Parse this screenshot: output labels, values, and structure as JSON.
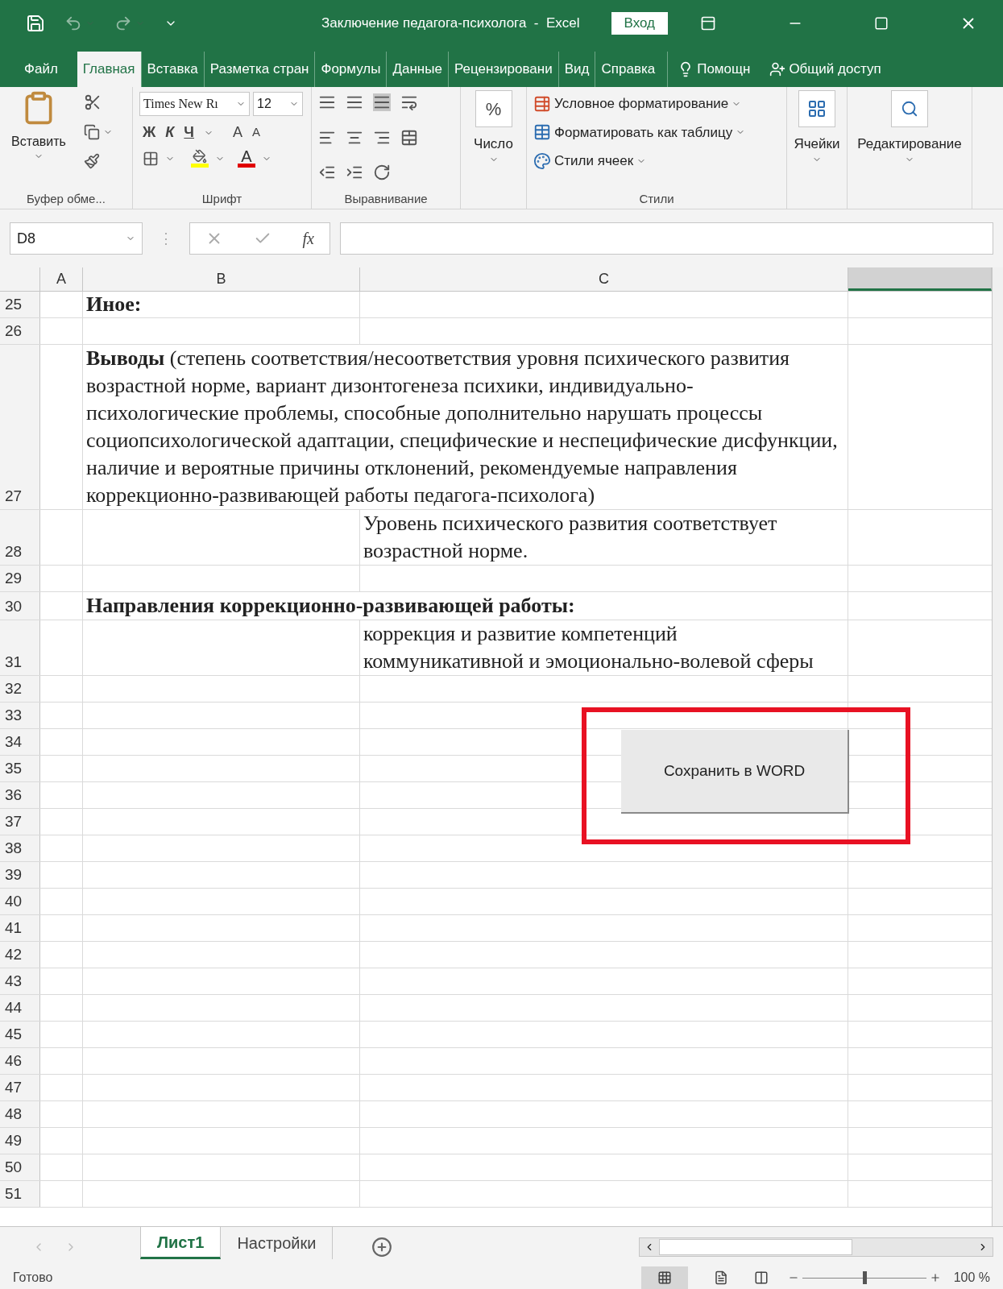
{
  "title_bar": {
    "title": "Заключение педагога-психолога  -  Excel",
    "sign_in": "Вход"
  },
  "ribbon_tabs": [
    {
      "label": "Файл",
      "kind": "tab",
      "selected": false
    },
    {
      "label": "Главная",
      "kind": "tab",
      "selected": true
    },
    {
      "label": "Вставка",
      "kind": "tab",
      "selected": false
    },
    {
      "label": "Разметка стран",
      "kind": "tab",
      "selected": false
    },
    {
      "label": "Формулы",
      "kind": "tab",
      "selected": false
    },
    {
      "label": "Данные",
      "kind": "tab",
      "selected": false
    },
    {
      "label": "Рецензировани",
      "kind": "tab",
      "selected": false
    },
    {
      "label": "Вид",
      "kind": "tab",
      "selected": false
    },
    {
      "label": "Справка",
      "kind": "tab",
      "selected": false
    },
    {
      "label": "Помощн",
      "kind": "search",
      "selected": false
    },
    {
      "label": "Общий доступ",
      "kind": "share",
      "selected": false
    }
  ],
  "ribbon": {
    "clipboard": {
      "paste": "Вставить",
      "label": "Буфер обме..."
    },
    "font": {
      "name": "Times New Rı",
      "size": "12",
      "bold": "Ж",
      "italic": "К",
      "underline": "Ч",
      "grow": "A",
      "shrink": "A",
      "text_color_letter": "A",
      "label": "Шрифт"
    },
    "alignment": {
      "label": "Выравнивание"
    },
    "number": {
      "symbol": "%",
      "format": "Число"
    },
    "styles": {
      "items": [
        "Условное форматирование",
        "Форматировать как таблицу",
        "Стили ячеек"
      ],
      "label": "Стили"
    },
    "cells": {
      "label": "Ячейки"
    },
    "editing": {
      "label": "Редактирование"
    }
  },
  "formula_bar": {
    "name_box": "D8",
    "separator": "⋮",
    "fx": "fx"
  },
  "columns": [
    {
      "letter": "A",
      "selected": false
    },
    {
      "letter": "B",
      "selected": false
    },
    {
      "letter": "C",
      "selected": false
    },
    {
      "selected": true
    }
  ],
  "rows": [
    {
      "number": "25",
      "kind": "plain",
      "b": "Иное:",
      "b_bold": true
    },
    {
      "number": "26",
      "kind": "plain"
    },
    {
      "number": "27",
      "kind": "merged",
      "b": "**Выводы** (степень соответствия/несоответствия уровня психического развития возрастной норме, вариант дизонтогенеза психики, индивидуально-психологические проблемы, способные дополнительно нарушать процессы социопсихологической адаптации, специфические и неспецифические дисфункции, наличие и вероятные причины отклонений, рекомендуемые направления коррекционно-развивающей работы педагога-психолога)",
      "b_bold": false
    },
    {
      "number": "28",
      "kind": "plain",
      "c": "Уровень психического развития соответствует возрастной норме."
    },
    {
      "number": "29",
      "kind": "plain"
    },
    {
      "number": "30",
      "kind": "merged",
      "b": "Направления коррекционно-развивающей работы:",
      "b_bold": true
    },
    {
      "number": "31",
      "kind": "plain",
      "c": "коррекция и развитие компетенций коммуникативной и эмоционально-волевой сферы"
    },
    {
      "number": "32",
      "kind": "plain"
    },
    {
      "number": "33",
      "kind": "plain"
    },
    {
      "number": "34",
      "kind": "plain"
    },
    {
      "number": "35",
      "kind": "plain"
    },
    {
      "number": "36",
      "kind": "plain"
    },
    {
      "number": "37",
      "kind": "plain"
    },
    {
      "number": "38",
      "kind": "plain"
    },
    {
      "number": "39",
      "kind": "plain"
    },
    {
      "number": "40",
      "kind": "plain"
    },
    {
      "number": "41",
      "kind": "plain"
    },
    {
      "number": "42",
      "kind": "plain"
    },
    {
      "number": "43",
      "kind": "plain"
    },
    {
      "number": "44",
      "kind": "plain"
    },
    {
      "number": "45",
      "kind": "plain"
    },
    {
      "number": "46",
      "kind": "plain"
    },
    {
      "number": "47",
      "kind": "plain"
    },
    {
      "number": "48",
      "kind": "plain"
    },
    {
      "number": "49",
      "kind": "plain"
    },
    {
      "number": "50",
      "kind": "plain"
    },
    {
      "number": "51",
      "kind": "plain"
    }
  ],
  "macro_button": {
    "label": "Сохранить в WORD"
  },
  "sheet_tabs": [
    {
      "label": "Лист1",
      "selected": true
    },
    {
      "label": "Настройки",
      "selected": false
    }
  ],
  "status_bar": {
    "status": "Готово",
    "zoom_slider": {
      "level": 0.5
    },
    "zoom": "100 %"
  }
}
